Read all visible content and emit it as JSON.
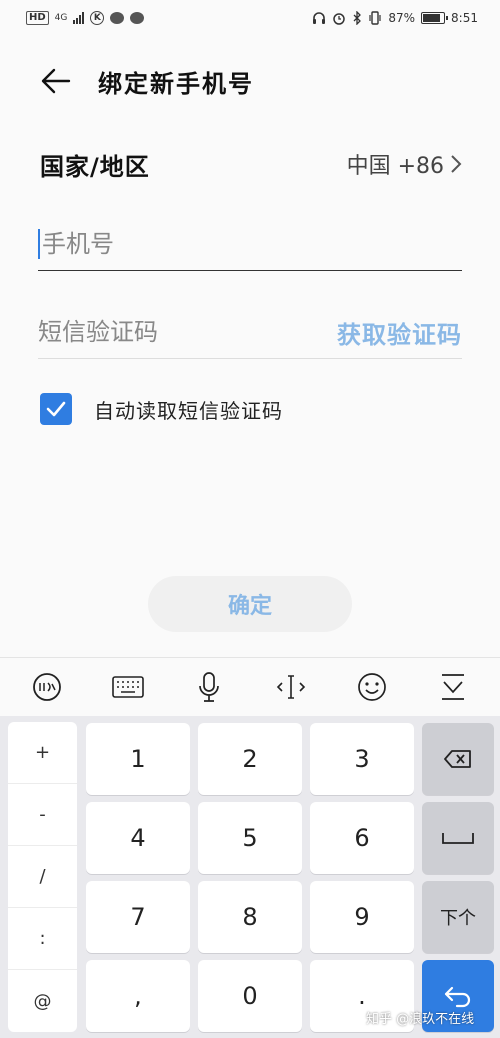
{
  "status_bar": {
    "hd": "HD",
    "signal_type": "4G",
    "k_badge": "K",
    "battery": "87",
    "time": "8:51"
  },
  "header": {
    "title": "绑定新手机号"
  },
  "form": {
    "country_label": "国家/地区",
    "country_value": "中国 +86",
    "phone_placeholder": "手机号",
    "sms_placeholder": "短信验证码",
    "get_code_label": "获取验证码",
    "auto_read_label": "自动读取短信验证码",
    "auto_read_checked": true,
    "confirm_label": "确定"
  },
  "keyboard": {
    "toolbar": [
      "xunfei-logo-icon",
      "keyboard-icon",
      "microphone-icon",
      "cursor-move-icon",
      "emoji-icon",
      "collapse-keyboard-icon"
    ],
    "symbols": [
      "+",
      "-",
      "/",
      ":",
      "@"
    ],
    "digits": [
      "1",
      "2",
      "3",
      "4",
      "5",
      "6",
      "7",
      "8",
      "9",
      ",",
      "0",
      "."
    ],
    "next_label": "下个"
  },
  "watermark": "知乎 @浪玖不在线",
  "colors": {
    "accent": "#2f7de1",
    "disabled_accent": "#8ab8e6"
  }
}
